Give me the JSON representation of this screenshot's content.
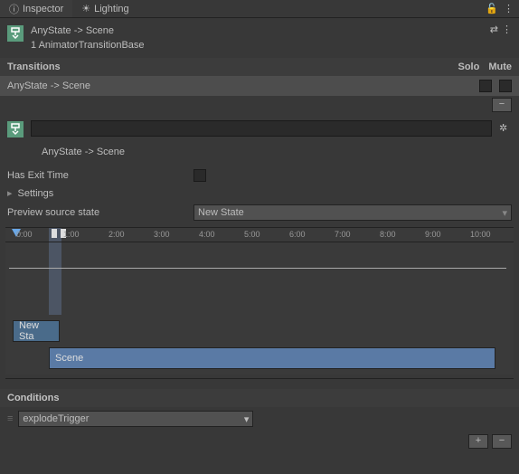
{
  "tabs": {
    "inspector": "Inspector",
    "lighting": "Lighting"
  },
  "header": {
    "title": "AnyState -> Scene",
    "sub": "1 AnimatorTransitionBase"
  },
  "transitions": {
    "label": "Transitions",
    "solo": "Solo",
    "mute": "Mute",
    "row": "AnyState -> Scene"
  },
  "named": "AnyState -> Scene",
  "hasExitTime": "Has Exit Time",
  "settings": "Settings",
  "preview": {
    "label": "Preview source state",
    "value": "New State"
  },
  "ticks": [
    "0:00",
    "1:00",
    "2:00",
    "3:00",
    "4:00",
    "5:00",
    "6:00",
    "7:00",
    "8:00",
    "9:00",
    "10:00"
  ],
  "clips": {
    "new": "New Sta",
    "scene": "Scene"
  },
  "conditions": {
    "label": "Conditions",
    "item": "explodeTrigger"
  },
  "glyph": {
    "minus": "−",
    "plus": "+",
    "dot": "⋮",
    "lock": "🔓",
    "arrow": "▾",
    "fold": "▸",
    "drag": "≡",
    "info": "ⓘ",
    "light": "☀",
    "opts": "⇄"
  }
}
